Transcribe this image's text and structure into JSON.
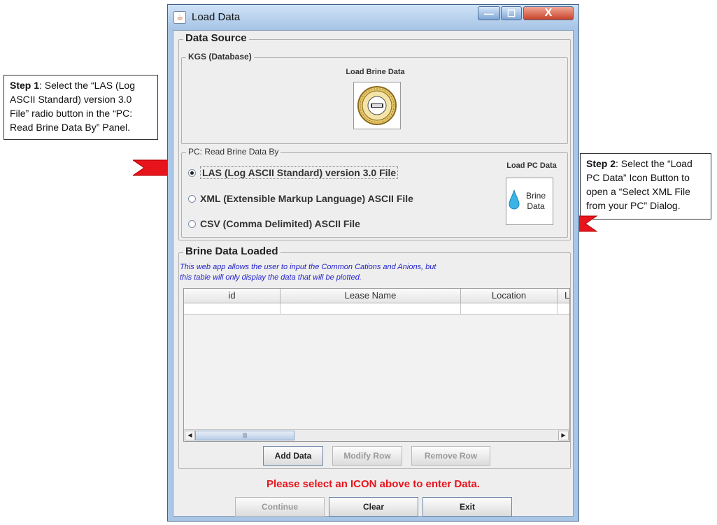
{
  "window": {
    "title": "Load Data",
    "controls": {
      "minimize": "—",
      "maximize": "☐",
      "close": "X"
    }
  },
  "data_source": {
    "title": "Data Source",
    "kgs": {
      "title": "KGS (Database)",
      "load_label": "Load Brine Data"
    },
    "pc": {
      "title": "PC: Read Brine Data By",
      "options": [
        {
          "label": "LAS (Log ASCII Standard) version 3.0 File",
          "selected": true
        },
        {
          "label": "XML (Extensible Markup Language) ASCII File",
          "selected": false
        },
        {
          "label": "CSV (Comma Delimited) ASCII File",
          "selected": false
        }
      ],
      "load_label": "Load PC Data",
      "icon_line1": "Brine",
      "icon_line2": "Data"
    }
  },
  "brine": {
    "title": "Brine Data Loaded",
    "note_line1": "This web app allows the user to input the Common Cations and Anions, but",
    "note_line2": "this table will only display the data that will be plotted.",
    "columns": [
      "id",
      "Lease Name",
      "Location",
      "La"
    ],
    "scroll_grip": "|||",
    "buttons": {
      "add": "Add Data",
      "modify": "Modify Row",
      "remove": "Remove Row"
    }
  },
  "status": "Please select an ICON above to enter Data.",
  "footer": {
    "continue": "Continue",
    "clear": "Clear",
    "exit": "Exit"
  },
  "callouts": {
    "step1": {
      "bold": "Step 1",
      "text": ": Select the “LAS (Log ASCII Standard) version 3.0 File” radio button in the “PC: Read Brine Data By” Panel."
    },
    "step2": {
      "bold": "Step 2",
      "text": ": Select the “Load PC Data” Icon Button to open a “Select XML File from your PC” Dialog."
    }
  },
  "colors": {
    "status_text": "#e8141c",
    "arrow": "#e8141c",
    "note_text": "#2222cc",
    "title_bar": "#a9c6e6"
  }
}
